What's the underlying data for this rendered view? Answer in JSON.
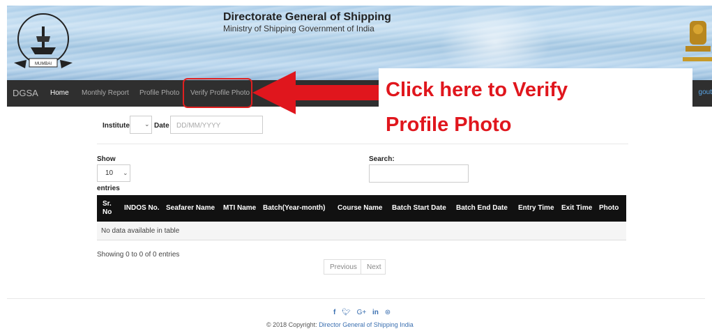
{
  "header": {
    "org_title": "Directorate General of Shipping",
    "org_subtitle": "Ministry of Shipping Government of India",
    "logo_top_text": "DIRECTORATE GENERAL OF SHIPPING",
    "logo_bottom_text": "MUMBAI"
  },
  "nav": {
    "brand": "DGSA",
    "items": [
      {
        "label": "Home"
      },
      {
        "label": "Monthly Report"
      },
      {
        "label": "Profile Photo"
      },
      {
        "label": "Verify Profile Photo"
      }
    ],
    "logout": "gout"
  },
  "annotation": {
    "callout_line1": "Click here to Verify",
    "callout_line2": "Profile Photo",
    "color": "#e0161d"
  },
  "filters": {
    "institute_label": "Institute",
    "date_label": "Date",
    "date_placeholder": "DD/MM/YYYY"
  },
  "table_controls": {
    "show_label": "Show",
    "entries_value": "10",
    "entries_label": "entries",
    "search_label": "Search:"
  },
  "table": {
    "columns": [
      "Sr. No",
      "INDOS No.",
      "Seafarer Name",
      "MTI Name",
      "Batch(Year-month)",
      "Course Name",
      "Batch Start Date",
      "Batch End Date",
      "Entry Time",
      "Exit Time",
      "Photo"
    ],
    "empty_message": "No data available in table",
    "info": "Showing 0 to 0 of 0 entries"
  },
  "pagination": {
    "previous": "Previous",
    "next": "Next"
  },
  "footer": {
    "social_icons": [
      "facebook-icon",
      "twitter-icon",
      "google-plus-icon",
      "linkedin-icon",
      "dribbble-icon"
    ],
    "copyright_prefix": "© 2018 Copyright: ",
    "copyright_link": "Director General of Shipping India"
  },
  "colors": {
    "navbar": "#2f2f2f",
    "table_header": "#111111",
    "link": "#3a6fb0"
  }
}
